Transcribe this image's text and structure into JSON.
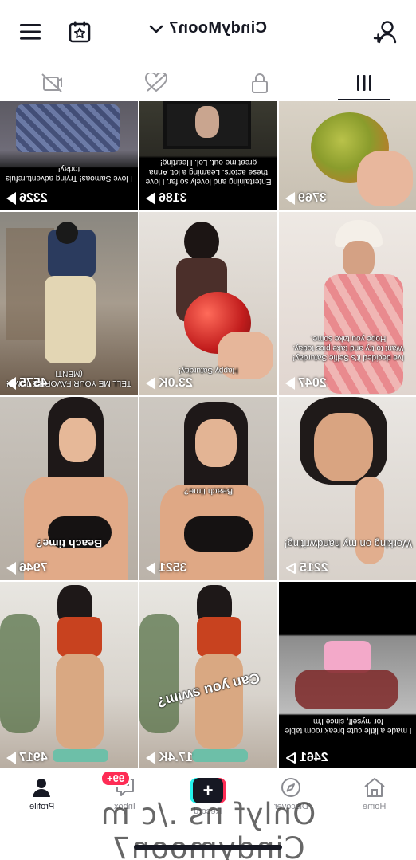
{
  "header": {
    "username": "CindyMoon7"
  },
  "tabs": [
    {
      "icon": "video-lock-icon",
      "active": false
    },
    {
      "icon": "liked-hidden-icon",
      "active": false
    },
    {
      "icon": "lock-icon",
      "active": false
    },
    {
      "icon": "grid-icon",
      "active": true
    }
  ],
  "videos": [
    {
      "views": "2326",
      "caption": "I love Samoas! Trying adventurefuls today!"
    },
    {
      "views": "3186",
      "caption": "Entertaining and lovely so far. I love these actors. Learning a lot. Anna great me out. Lol. Hearting!"
    },
    {
      "views": "3769",
      "caption": ""
    },
    {
      "views": "4575",
      "caption": "TELL ME YOUR FAVORITE JUMP! (MENTI"
    },
    {
      "views": "23.0K",
      "caption": "Happy Saturday!"
    },
    {
      "views": "2047",
      "caption": "Ive decided it's Selfie Saturday! Want to try and take pics today. Hope you take some."
    },
    {
      "views": "7946",
      "caption": "Beach time?"
    },
    {
      "views": "3521",
      "caption": "Beach time?"
    },
    {
      "views": "2215",
      "caption": "Working on my handwriting!"
    },
    {
      "views": "4917",
      "caption": ""
    },
    {
      "views": "17.4K",
      "caption": "Can you swim?"
    },
    {
      "views": "2461",
      "caption": "I made a little cute break room table for myself, since I'm"
    }
  ],
  "nav": {
    "home": "Home",
    "discover": "Discover",
    "record": "Record",
    "inbox": "Inbox",
    "inbox_badge": "99+",
    "profile": "Profile"
  },
  "watermark": "Onlyf ns ./c m Cindymoon7",
  "colors": {
    "accent_red": "#fe2c55",
    "accent_cyan": "#25f4ee",
    "text_dark": "#161823"
  }
}
